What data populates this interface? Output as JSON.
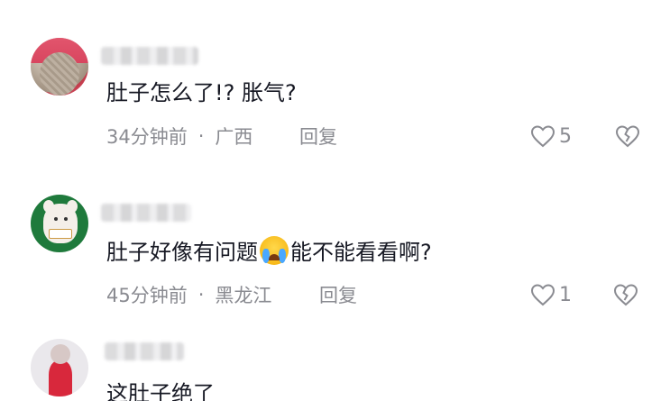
{
  "comments": [
    {
      "text": "肚子怎么了!? 胀气?",
      "time": "34分钟前",
      "location": "广西",
      "reply_label": "回复",
      "likes": "5"
    },
    {
      "text_before": "肚子好像有问题",
      "text_after": "能不能看看啊?",
      "time": "45分钟前",
      "location": "黑龙江",
      "reply_label": "回复",
      "likes": "1"
    },
    {
      "text": "这肚子绝了"
    }
  ],
  "separator": "·",
  "icons": {
    "like": "heart-outline-icon",
    "dislike": "broken-heart-icon",
    "emoji": "crying-face-emoji"
  },
  "colors": {
    "text": "#161823",
    "meta": "#8a8b91",
    "background": "#ffffff"
  }
}
